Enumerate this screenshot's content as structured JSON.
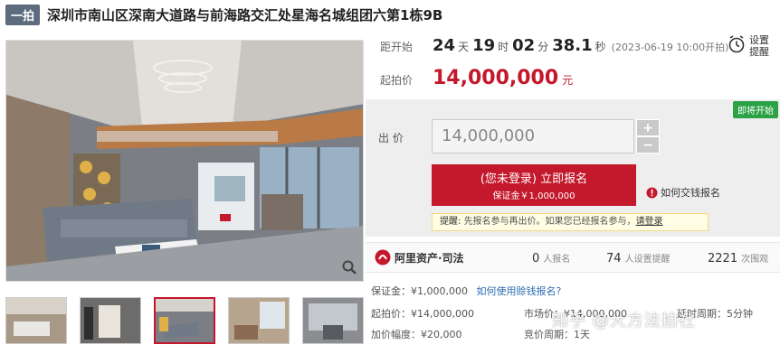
{
  "header": {
    "tag": "一拍",
    "title": "深圳市南山区深南大道路与前海路交汇处星海名城组团六第1栋9B"
  },
  "countdown": {
    "label": "距开始",
    "days": "24",
    "days_unit": "天",
    "hours": "19",
    "hours_unit": "时",
    "minutes": "02",
    "minutes_unit": "分",
    "seconds": "38.1",
    "seconds_unit": "秒",
    "start_time": "(2023-06-19 10:00开拍)"
  },
  "reminder": {
    "line1": "设置",
    "line2": "提醒"
  },
  "starting_price": {
    "label": "起拍价",
    "value": "14,000,000",
    "unit": "元"
  },
  "bid": {
    "badge": "即将开始",
    "label": "出  价",
    "input_value": "14,000,000",
    "plus": "+",
    "minus": "−",
    "signup_main": "(您未登录) 立即报名",
    "signup_sub": "保证金￥1,000,000",
    "how_pay": "如何交钱报名",
    "tip_prefix": "提醒:",
    "tip_text": "先报名参与再出价。如果您已经报名参与，",
    "tip_link": "请登录"
  },
  "stats": {
    "brand": "阿里资产·司法",
    "signups_num": "0",
    "signups_label": "人报名",
    "reminders_num": "74",
    "reminders_label": "人设置提醒",
    "views_num": "2221",
    "views_label": "次围观"
  },
  "details": {
    "deposit": "保证金：¥1,000,000",
    "deposit_link": "如何使用赊钱报名?",
    "start_price": "起拍价：¥14,000,000",
    "market_price": "市场价：¥14,000,000",
    "delay": "延时周期：5分钟",
    "increment": "加价幅度：¥20,000",
    "cycle": "竞价周期：1天"
  },
  "watermark": "知乎 @大方法拍社",
  "colors": {
    "accent": "#c4182c",
    "badge_green": "#2ba245"
  }
}
